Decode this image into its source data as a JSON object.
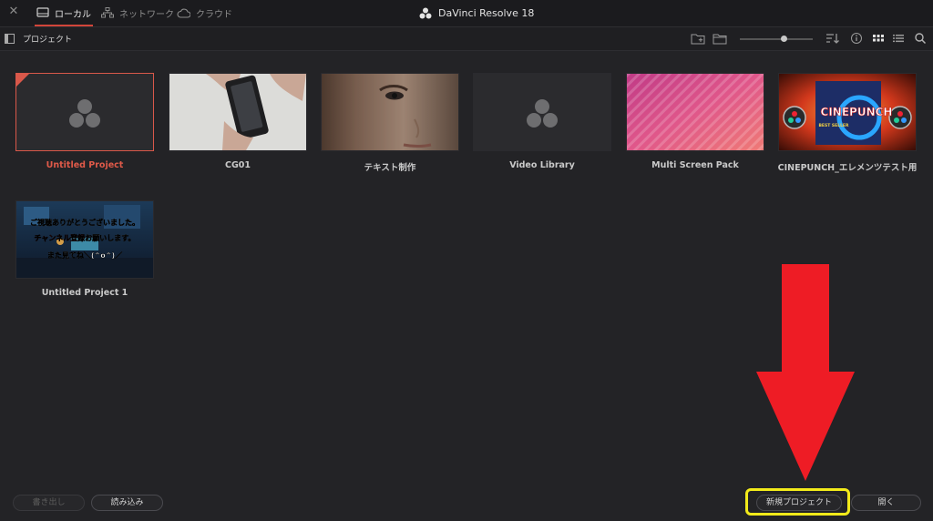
{
  "app": {
    "title": "DaVinci Resolve 18"
  },
  "tabs": [
    {
      "label": "ローカル",
      "active": true
    },
    {
      "label": "ネットワーク",
      "active": false
    },
    {
      "label": "クラウド",
      "active": false
    }
  ],
  "toolbar": {
    "section_label": "プロジェクト",
    "zoom_slider_level": 0.6
  },
  "projects": [
    {
      "name": "Untitled Project",
      "selected": true,
      "thumbnail": "resolve-placeholder"
    },
    {
      "name": "CG01",
      "selected": false,
      "thumbnail": "hand-holding-phone"
    },
    {
      "name": "テキスト制作",
      "selected": false,
      "thumbnail": "face-closeup"
    },
    {
      "name": "Video Library",
      "selected": false,
      "thumbnail": "resolve-placeholder"
    },
    {
      "name": "Multi Screen Pack",
      "selected": false,
      "thumbnail": "pink-pattern"
    },
    {
      "name": "CINEPUNCH_エレメンツテスト用",
      "selected": false,
      "thumbnail": "cinepunch-art"
    },
    {
      "name": "Untitled Project 1",
      "selected": false,
      "thumbnail": "night-room-caption"
    }
  ],
  "thumb_text": {
    "cinepunch": "CINEPUNCH",
    "best_seller": "BEST SELLER",
    "caption_1": "ご視聴ありがとうございました。",
    "caption_2a": "チャンネル登録",
    "caption_2b": "お願いします。",
    "caption_3": "また見てね＼(^o^)／"
  },
  "buttons": {
    "export": "書き出し",
    "import": "読み込み",
    "new_project": "新規プロジェクト",
    "open": "開く"
  },
  "colors": {
    "accent": "#d9584a",
    "background": "#232326",
    "highlight_box": "#f2ea1a",
    "annotation_arrow": "#ee1c25"
  }
}
